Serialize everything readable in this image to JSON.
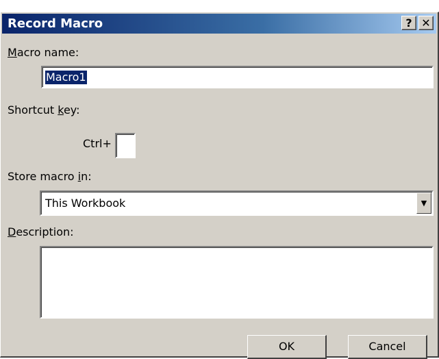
{
  "dialog": {
    "title": "Record Macro",
    "help_button": "?",
    "close_button": "✕"
  },
  "macro_name": {
    "label_accel": "M",
    "label_rest": "acro name:",
    "value": "Macro1"
  },
  "shortcut": {
    "label_pre": "Shortcut ",
    "label_accel": "k",
    "label_post": "ey:",
    "prefix": "Ctrl+",
    "value": ""
  },
  "store_in": {
    "label_pre": "Store macro ",
    "label_accel": "i",
    "label_post": "n:",
    "selected": "This Workbook"
  },
  "description": {
    "label_accel": "D",
    "label_rest": "escription:",
    "value": ""
  },
  "buttons": {
    "ok": "OK",
    "cancel": "Cancel"
  }
}
